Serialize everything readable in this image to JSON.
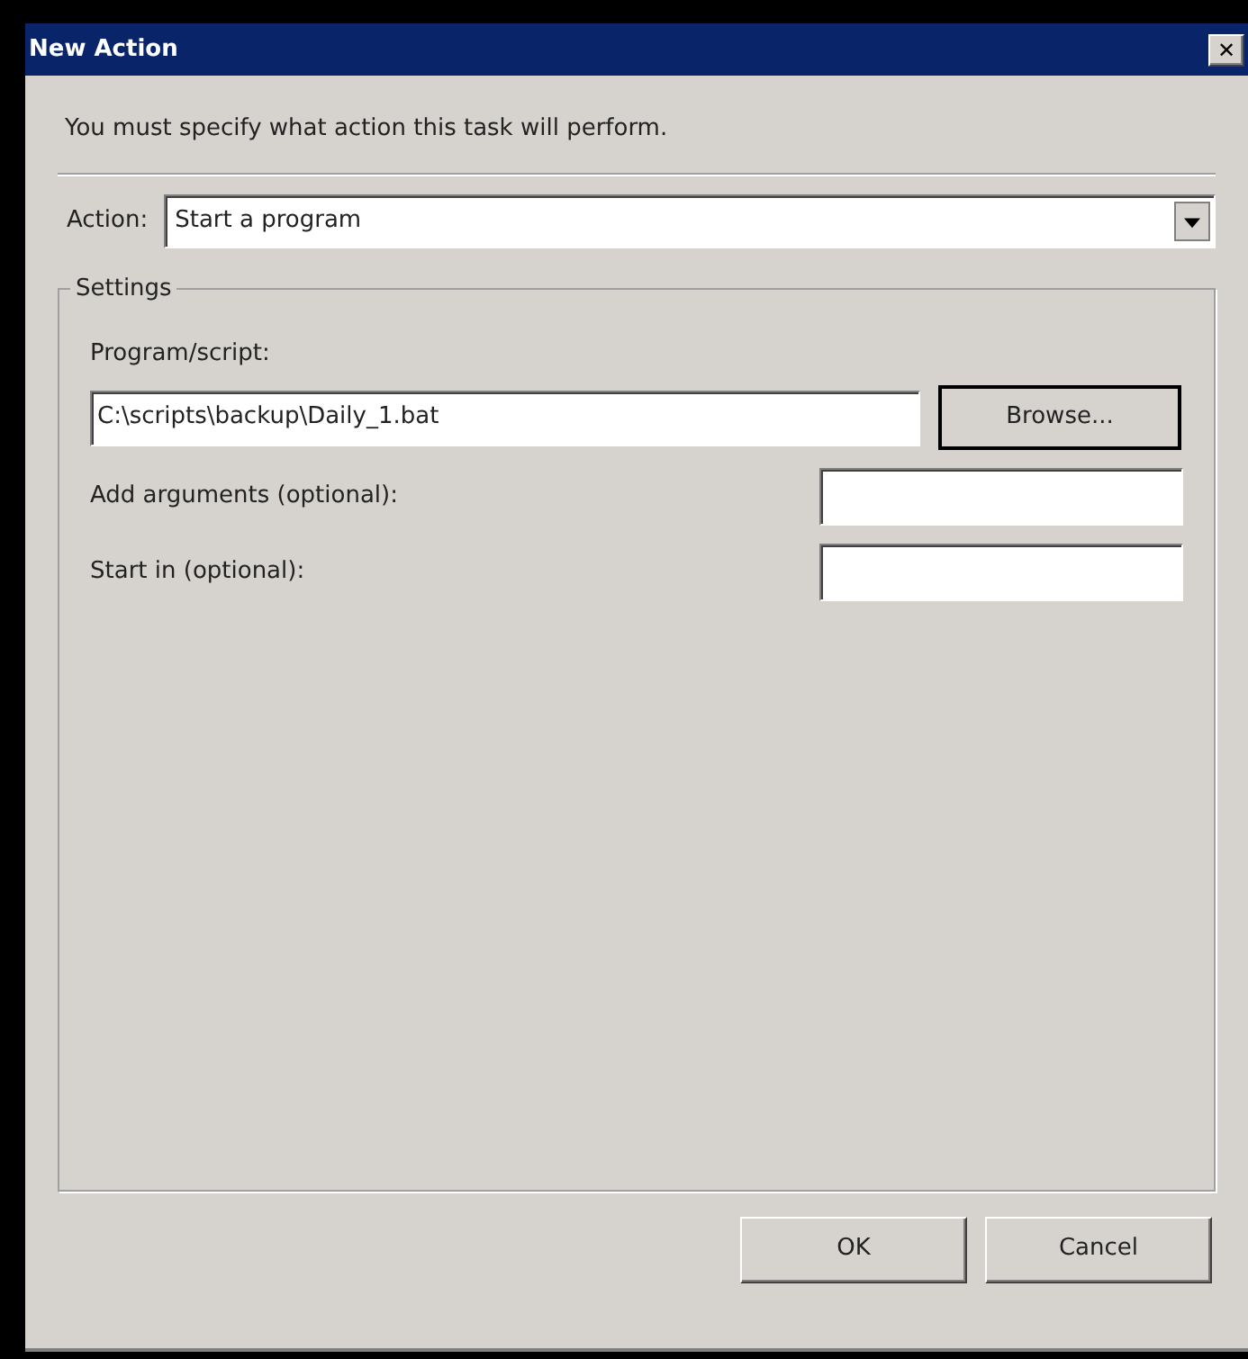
{
  "window": {
    "title": "New Action",
    "close": "✕"
  },
  "instruction": "You must specify what action this task will perform.",
  "action": {
    "label": "Action:",
    "value": "Start a program"
  },
  "settings": {
    "legend": "Settings",
    "program": {
      "label": "Program/script:",
      "value": "C:\\scripts\\backup\\Daily_1.bat",
      "button": "Browse..."
    },
    "fields": [
      {
        "label": "Add arguments (optional):"
      },
      {
        "label": "Start in (optional):"
      }
    ]
  },
  "buttons": [
    "OK",
    "Cancel"
  ]
}
